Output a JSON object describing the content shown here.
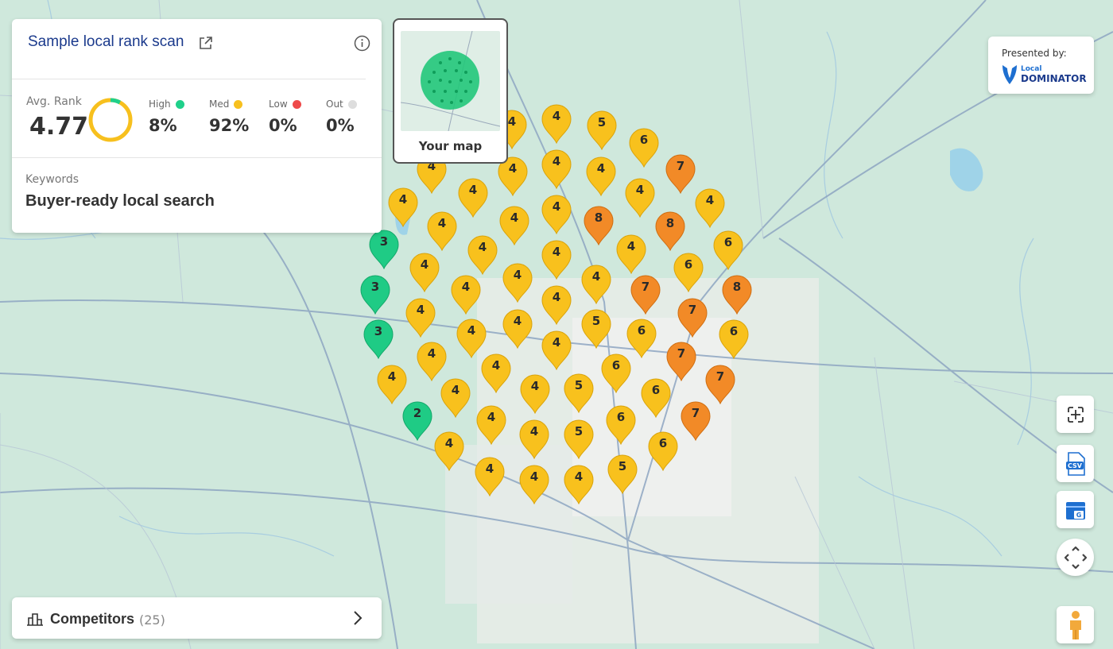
{
  "scan": {
    "title": "Sample local rank scan",
    "avg_rank_label": "Avg. Rank",
    "avg_rank_value": "4.77",
    "stats": [
      {
        "label": "High",
        "value": "8%",
        "color": "#1fd08a"
      },
      {
        "label": "Med",
        "value": "92%",
        "color": "#f7c01e"
      },
      {
        "label": "Low",
        "value": "0%",
        "color": "#ee4a4a"
      },
      {
        "label": "Out",
        "value": "0%",
        "color": "#dddddd"
      }
    ],
    "keywords_label": "Keywords",
    "keyword": "Buyer-ready local search"
  },
  "mini_map": {
    "label": "Your map"
  },
  "presented": {
    "label": "Presented by:",
    "brand_small": "Local",
    "brand_big": "DOMINATOR"
  },
  "competitors": {
    "label": "Competitors",
    "count": "(25)"
  },
  "tools": [
    {
      "name": "fullscreen-icon"
    },
    {
      "name": "csv-export-icon"
    },
    {
      "name": "google-business-icon"
    },
    {
      "name": "pan-arrows-icon"
    },
    {
      "name": "street-view-pegman-icon"
    }
  ],
  "colors": {
    "green": "#1fcb85",
    "yellow": "#f8c11d",
    "orange": "#f28a27",
    "accent": "#1b3a8c"
  },
  "pins": [
    {
      "rank": 4
    },
    {
      "rank": 4
    },
    {
      "rank": 5
    },
    {
      "rank": 6
    },
    {
      "rank": 4
    },
    {
      "rank": 4
    },
    {
      "rank": 4
    },
    {
      "rank": 4
    },
    {
      "rank": 7
    },
    {
      "rank": 4
    },
    {
      "rank": 4
    },
    {
      "rank": 4
    },
    {
      "rank": 4
    },
    {
      "rank": 4
    },
    {
      "rank": 8
    },
    {
      "rank": 4
    },
    {
      "rank": 4
    },
    {
      "rank": 4
    },
    {
      "rank": 4
    },
    {
      "rank": 8
    },
    {
      "rank": 3
    },
    {
      "rank": 4
    },
    {
      "rank": 4
    },
    {
      "rank": 4
    },
    {
      "rank": 6
    },
    {
      "rank": 6
    },
    {
      "rank": 4
    },
    {
      "rank": 4
    },
    {
      "rank": 4
    },
    {
      "rank": 4
    },
    {
      "rank": 3
    },
    {
      "rank": 4
    },
    {
      "rank": 4
    },
    {
      "rank": 7
    },
    {
      "rank": 8
    },
    {
      "rank": 4
    },
    {
      "rank": 4
    },
    {
      "rank": 4
    },
    {
      "rank": 4
    },
    {
      "rank": 5
    },
    {
      "rank": 6
    },
    {
      "rank": 7
    },
    {
      "rank": 3
    },
    {
      "rank": 6
    },
    {
      "rank": 4
    },
    {
      "rank": 4
    },
    {
      "rank": 4
    },
    {
      "rank": 6
    },
    {
      "rank": 7
    },
    {
      "rank": 4
    },
    {
      "rank": 4
    },
    {
      "rank": 4
    },
    {
      "rank": 5
    },
    {
      "rank": 6
    },
    {
      "rank": 7
    },
    {
      "rank": 2
    },
    {
      "rank": 5
    },
    {
      "rank": 6
    },
    {
      "rank": 7
    },
    {
      "rank": 4
    },
    {
      "rank": 4
    },
    {
      "rank": 5
    },
    {
      "rank": 6
    },
    {
      "rank": 4
    },
    {
      "rank": 3
    },
    {
      "rank": 5
    },
    {
      "rank": 5
    }
  ]
}
